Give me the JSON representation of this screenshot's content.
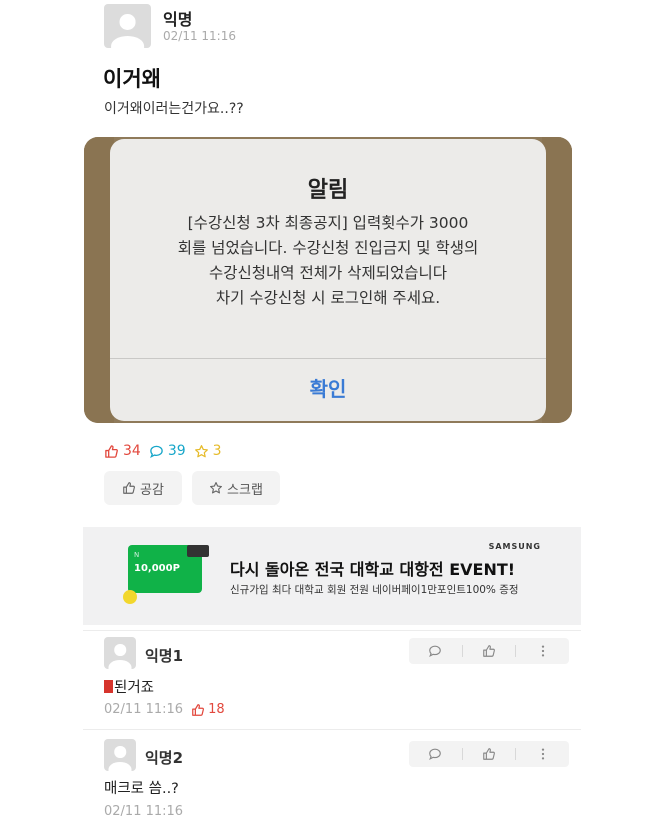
{
  "post": {
    "author": "익명",
    "time": "02/11 11:16",
    "title": "이거왜",
    "body": "이거왜이러는건가요..??"
  },
  "alert_image": {
    "title": "알림",
    "message_lines": [
      "[수강신청 3차 최종공지] 입력횟수가 3000",
      "회를 넘었습니다. 수강신청 진입금지 및 학생의",
      "수강신청내역 전체가 삭제되었습니다",
      "차기 수강신청 시 로그인해 주세요."
    ],
    "confirm_label": "확인"
  },
  "stats": {
    "likes": "34",
    "comments": "39",
    "scraps": "3"
  },
  "actions": {
    "like_label": "공감",
    "scrap_label": "스크랩"
  },
  "ad": {
    "brand": "SAMSUNG",
    "headline": "다시 돌아온 전국 대학교 대항전 EVENT!",
    "subtext": "신규가입 최다 대학교 회원 전원 네이버페이1만포인트100% 증정",
    "card_amount": "10,000P"
  },
  "comments": [
    {
      "author": "익명1",
      "text": "된거죠",
      "time": "02/11 11:16",
      "likes": "18"
    },
    {
      "author": "익명2",
      "text": "매크로 씀..?",
      "time": "02/11 11:16"
    }
  ],
  "colors": {
    "like": "#e2483d",
    "comment": "#17a6c9",
    "scrap": "#e6bb2a",
    "confirm": "#3a7bd5",
    "ad_card": "#10b248"
  }
}
